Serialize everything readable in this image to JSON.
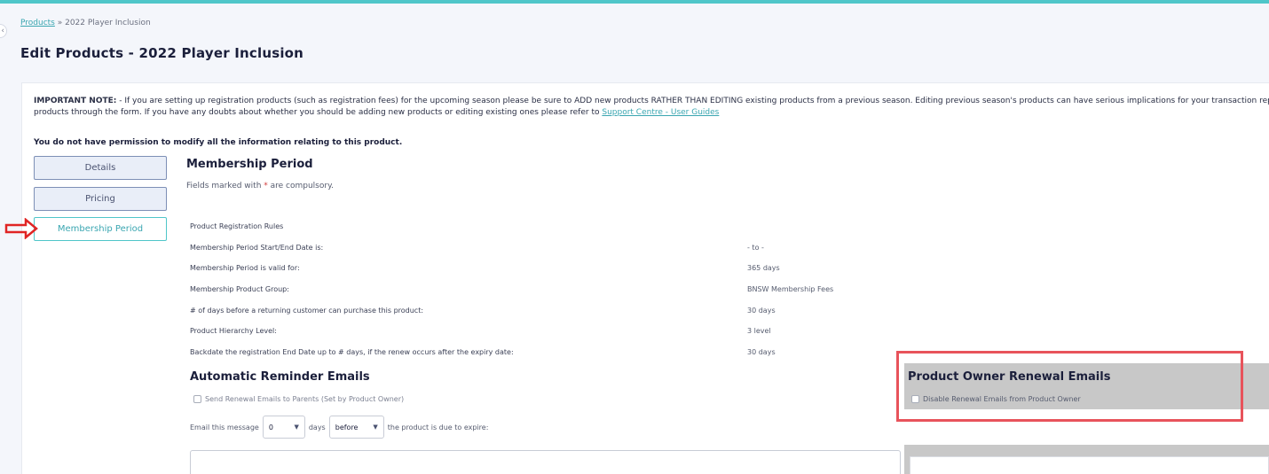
{
  "breadcrumb": {
    "link": "Products",
    "separator": " » ",
    "current": "2022 Player Inclusion"
  },
  "page": {
    "title": "Edit Products - 2022 Player Inclusion"
  },
  "note": {
    "prefix": "IMPORTANT NOTE:",
    "line1": " - If you are setting up registration products (such as registration fees) for the upcoming season please be sure to ADD new products RATHER THAN EDITING existing products from a previous season. Editing previous season's products can have serious implications for your transaction report",
    "line2": "products through the form. If you have any doubts about whether you should be adding new products or editing existing ones please refer to ",
    "link": "Support Centre - User Guides"
  },
  "permission": "You do not have permission to modify all the information relating to this product.",
  "sidebar": {
    "items": [
      {
        "label": "Details"
      },
      {
        "label": "Pricing"
      },
      {
        "label": "Membership Period",
        "active": true
      }
    ]
  },
  "membership": {
    "title": "Membership Period",
    "hint_before": "Fields marked with ",
    "hint_star": "*",
    "hint_after": " are compulsory.",
    "rules_heading": "Product Registration Rules",
    "rules": [
      {
        "label": "Membership Period Start/End Date is:",
        "value": "- to -"
      },
      {
        "label": "Membership Period is valid for:",
        "value": "365 days"
      },
      {
        "label": "Membership Product Group:",
        "value": "BNSW Membership Fees"
      },
      {
        "label": "# of days before a returning customer can purchase this product:",
        "value": "30 days"
      },
      {
        "label": "Product Hierarchy Level:",
        "value": "3 level"
      },
      {
        "label": "Backdate the registration End Date up to # days, if the renew occurs after the expiry date:",
        "value": "30 days"
      }
    ]
  },
  "reminders": {
    "title": "Automatic Reminder Emails",
    "send_parents_label": "Send Renewal Emails to Parents (Set by Product Owner)",
    "email_prefix": "Email this message",
    "days_value": "0",
    "days_label": "days",
    "timing_value": "before",
    "email_suffix": "the product is due to expire:"
  },
  "owner": {
    "title": "Product Owner Renewal Emails",
    "disable_label": "Disable Renewal Emails from Product Owner"
  },
  "colors": {
    "accent": "#4fc6c9",
    "highlight": "#e8535b",
    "arrow": "#e02424"
  }
}
